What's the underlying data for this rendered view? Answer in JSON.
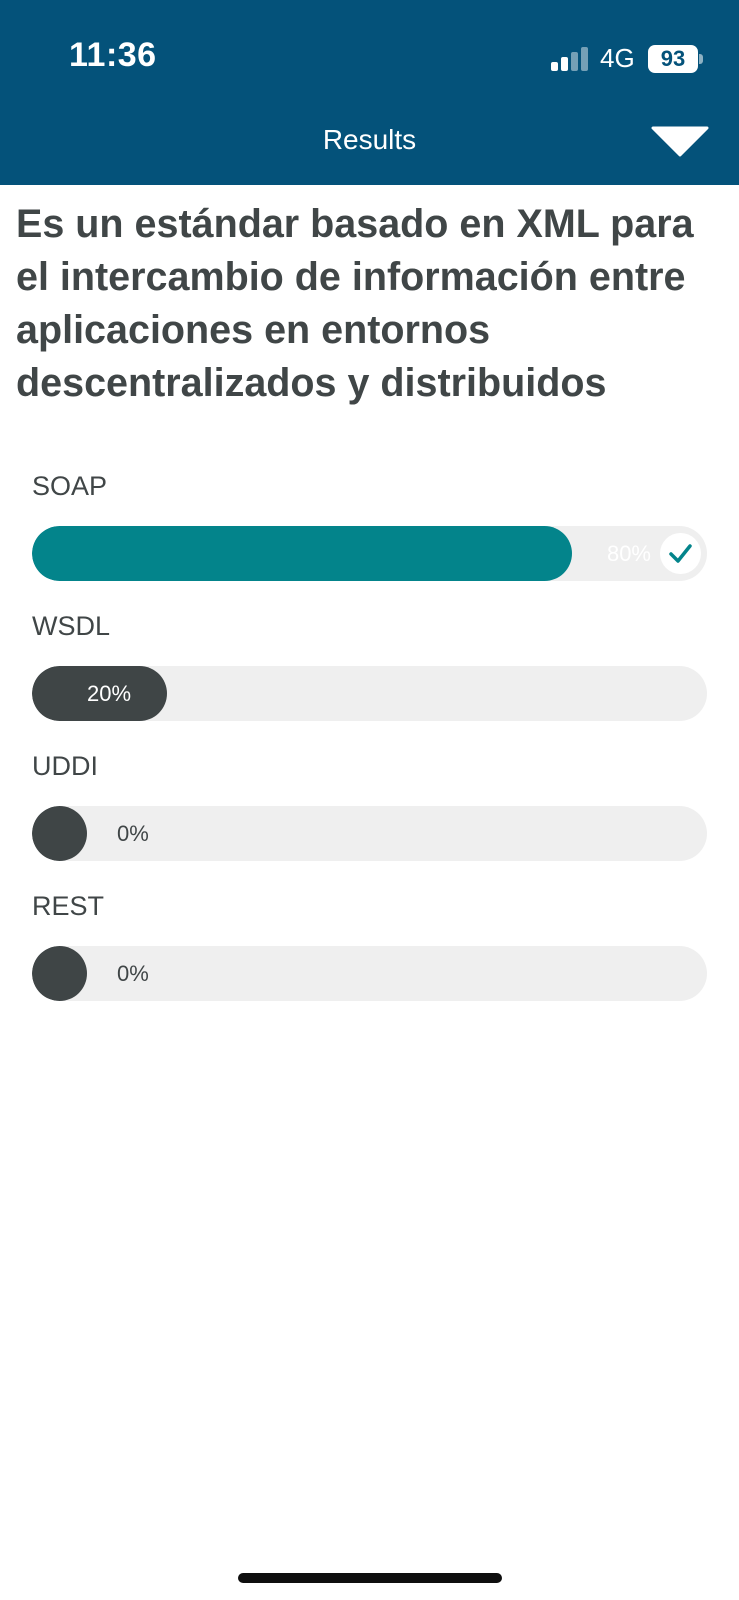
{
  "status_bar": {
    "time": "11:36",
    "network": "4G",
    "battery": "93"
  },
  "header": {
    "title": "Results",
    "background_color": "#04527a"
  },
  "question": {
    "text": "Es un estándar basado en XML para el intercambio de información entre aplicaciones en entornos descentralizados y distribuidos"
  },
  "options": [
    {
      "label": "SOAP",
      "percent": 80,
      "percent_label": "80%",
      "correct": true,
      "fill_color": "#03848b"
    },
    {
      "label": "WSDL",
      "percent": 20,
      "percent_label": "20%",
      "correct": false,
      "fill_color": "#3f4546"
    },
    {
      "label": "UDDI",
      "percent": 0,
      "percent_label": "0%",
      "correct": false,
      "fill_color": "#3f4546"
    },
    {
      "label": "REST",
      "percent": 0,
      "percent_label": "0%",
      "correct": false,
      "fill_color": "#3f4546"
    }
  ],
  "colors": {
    "track": "#efefef",
    "text": "#404647",
    "correct": "#03848b"
  }
}
